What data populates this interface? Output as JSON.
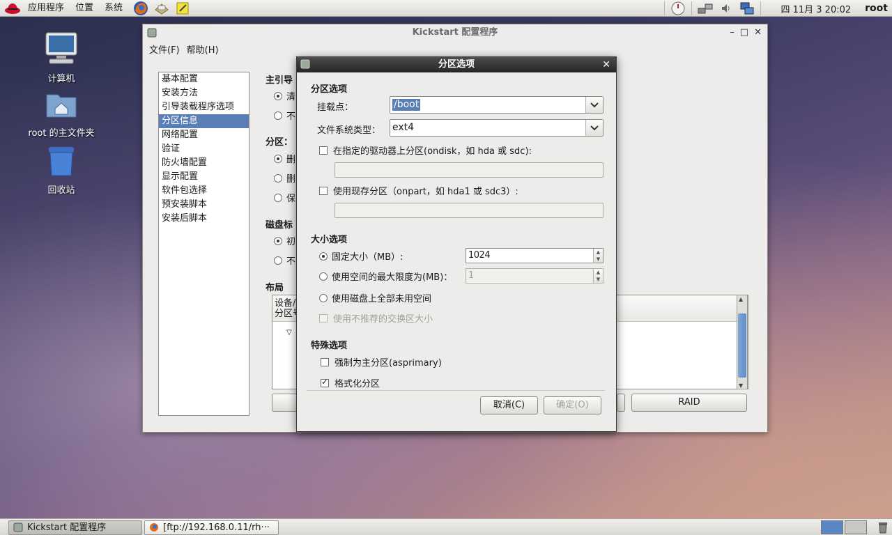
{
  "top_panel": {
    "menus": [
      "应用程序",
      "位置",
      "系统"
    ],
    "clock": "四 11月  3 20:02",
    "user": "root"
  },
  "desktop": {
    "icons": [
      "计算机",
      "root 的主文件夹",
      "回收站"
    ]
  },
  "main_window": {
    "title": "Kickstart 配置程序",
    "menu": [
      "文件(F)",
      "帮助(H)"
    ],
    "sidebar": [
      "基本配置",
      "安装方法",
      "引导装载程序选项",
      "分区信息",
      "网络配置",
      "验证",
      "防火墙配置",
      "显示配置",
      "软件包选择",
      "预安装脚本",
      "安装后脚本"
    ],
    "selected_sidebar_index": 3,
    "sections": {
      "mbr_label": "主引导",
      "mbr_options": [
        "清",
        "不"
      ],
      "partition_label": "分区：",
      "partition_options": [
        "删",
        "删",
        "保"
      ],
      "disklabel_label": "磁盘标",
      "disklabel_options": [
        "初",
        "不"
      ],
      "layout_label": "布局"
    },
    "tree_header": [
      "设备/",
      "分区号"
    ],
    "raid_button": "RAID"
  },
  "dialog": {
    "title": "分区选项",
    "section_partition": "分区选项",
    "mount_label": "挂载点：",
    "mount_value": "/boot",
    "fstype_label": "文件系统类型：",
    "fstype_value": "ext4",
    "ondisk_label": "在指定的驱动器上分区(ondisk，如 hda 或 sdc):",
    "onpart_label": "使用现存分区（onpart，如 hda1 或 sdc3）:",
    "section_size": "大小选项",
    "fixed_label": "固定大小（MB）:",
    "fixed_value": "1024",
    "max_label": "使用空间的最大限度为(MB)：",
    "max_value": "1",
    "fill_label": "使用磁盘上全部未用空间",
    "swap_label": "使用不推荐的交换区大小",
    "section_special": "特殊选项",
    "primary_label": "强制为主分区(asprimary)",
    "format_label": "格式化分区",
    "cancel_label": "取消(C)",
    "ok_label": "确定(O)"
  },
  "taskbar": {
    "tasks": [
      "Kickstart 配置程序",
      "[ftp://192.168.0.11/rh···"
    ]
  }
}
